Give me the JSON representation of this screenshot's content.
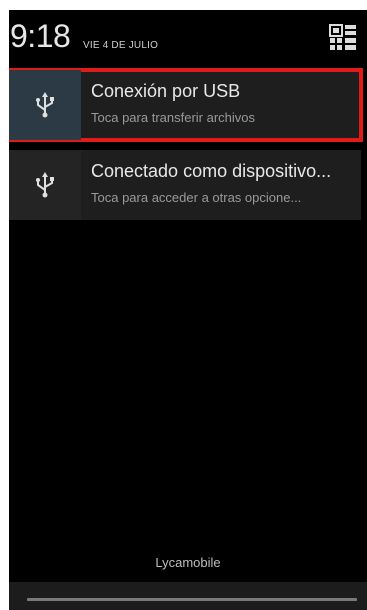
{
  "status": {
    "time": "9:18",
    "date": "VIE 4 DE JULIO"
  },
  "icons": {
    "settings": "quick-settings-icon",
    "usb": "usb-icon"
  },
  "notifications": [
    {
      "title": "Conexión por USB",
      "subtitle": "Toca para transferir archivos",
      "selected": true
    },
    {
      "title": "Conectado como dispositivo...",
      "subtitle": "Toca para acceder a otras opcione..."
    }
  ],
  "carrier": "Lycamobile",
  "colors": {
    "highlight": "#e11a1a",
    "background": "#000000",
    "panel": "#1e1e1e"
  }
}
